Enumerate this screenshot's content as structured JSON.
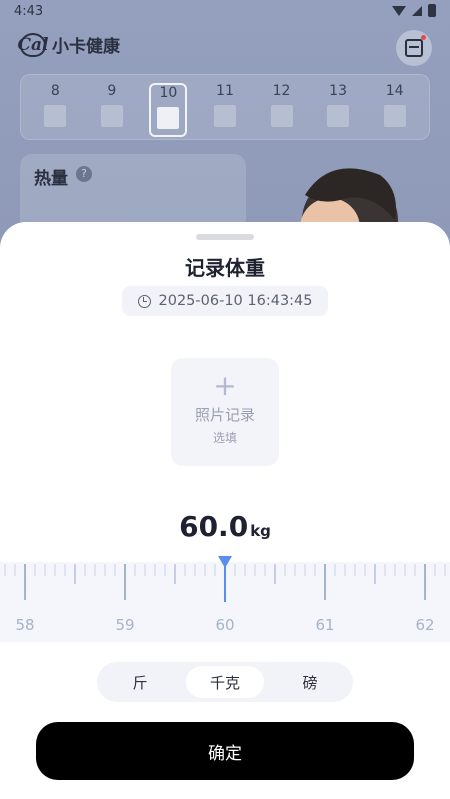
{
  "status_bar": {
    "time": "4:43"
  },
  "header": {
    "app_name": "小卡健康",
    "logo_text": "Cal"
  },
  "week": {
    "days": [
      "8",
      "9",
      "10",
      "11",
      "12",
      "13",
      "14"
    ],
    "selected": "10"
  },
  "calorie_card": {
    "title": "热量",
    "help": "?"
  },
  "sheet": {
    "title": "记录体重",
    "datetime": "2025-06-10 16:43:45",
    "photo": {
      "plus": "+",
      "label": "照片记录",
      "hint": "选填"
    },
    "weight": {
      "value": "60.0",
      "unit": "kg"
    },
    "ruler": {
      "labels": [
        "58",
        "59",
        "60",
        "61",
        "62"
      ],
      "current": 60.0
    },
    "unit_options": [
      "斤",
      "千克",
      "磅"
    ],
    "selected_unit": "千克",
    "confirm_label": "确定"
  },
  "colors": {
    "accent": "#5b8def",
    "confirm_bg": "#000000"
  }
}
